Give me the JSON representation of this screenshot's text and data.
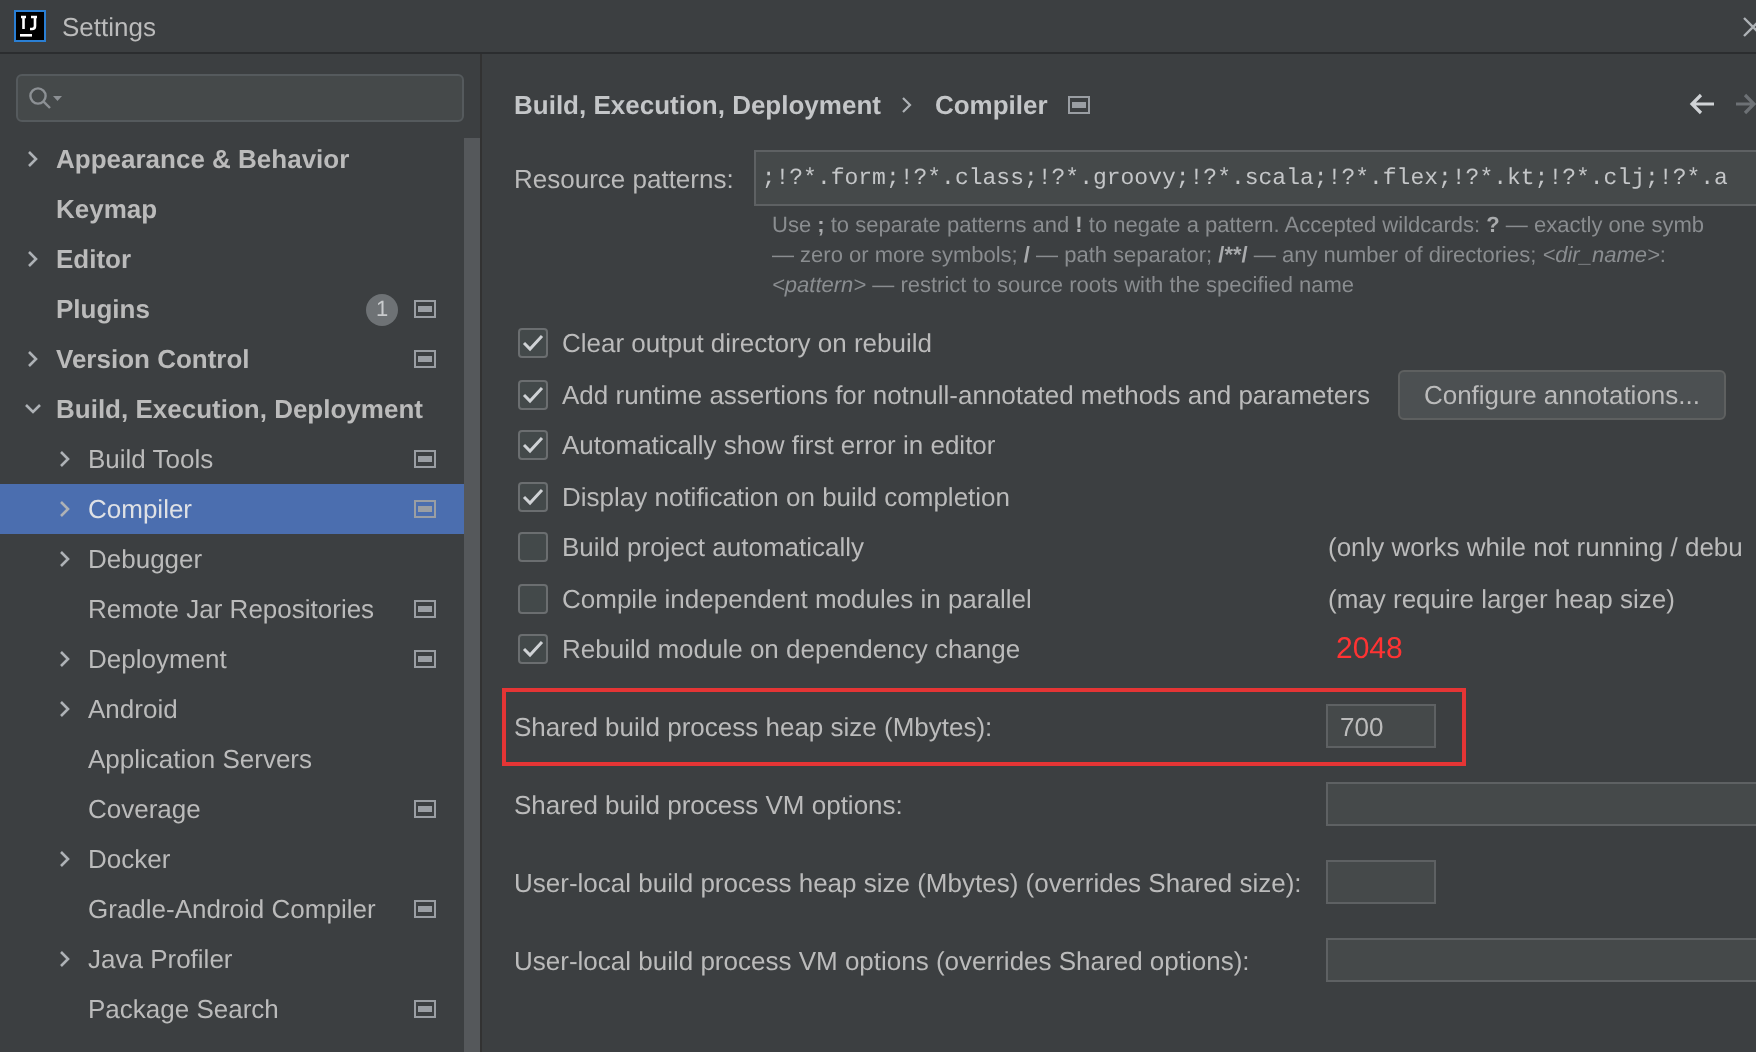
{
  "window": {
    "title": "Settings"
  },
  "sidebar": {
    "items": [
      {
        "label": "Appearance & Behavior",
        "expanded": false,
        "selected": false,
        "scoped": false
      },
      {
        "label": "Keymap",
        "selected": false,
        "scoped": false
      },
      {
        "label": "Editor",
        "expanded": false,
        "selected": false,
        "scoped": false
      },
      {
        "label": "Plugins",
        "selected": false,
        "badge": "1",
        "scoped": true
      },
      {
        "label": "Version Control",
        "expanded": false,
        "selected": false,
        "scoped": true
      },
      {
        "label": "Build, Execution, Deployment",
        "expanded": true,
        "selected": false,
        "scoped": false,
        "children": [
          {
            "label": "Build Tools",
            "expanded": false,
            "selected": false,
            "scoped": true
          },
          {
            "label": "Compiler",
            "expanded": false,
            "selected": true,
            "scoped": true
          },
          {
            "label": "Debugger",
            "expanded": false,
            "selected": false,
            "scoped": false
          },
          {
            "label": "Remote Jar Repositories",
            "selected": false,
            "scoped": true
          },
          {
            "label": "Deployment",
            "expanded": false,
            "selected": false,
            "scoped": true
          },
          {
            "label": "Android",
            "expanded": false,
            "selected": false,
            "scoped": false
          },
          {
            "label": "Application Servers",
            "selected": false,
            "scoped": false
          },
          {
            "label": "Coverage",
            "selected": false,
            "scoped": true
          },
          {
            "label": "Docker",
            "expanded": false,
            "selected": false,
            "scoped": false
          },
          {
            "label": "Gradle-Android Compiler",
            "selected": false,
            "scoped": true
          },
          {
            "label": "Java Profiler",
            "expanded": false,
            "selected": false,
            "scoped": false
          },
          {
            "label": "Package Search",
            "selected": false,
            "scoped": true
          }
        ]
      }
    ]
  },
  "breadcrumb": [
    "Build, Execution, Deployment",
    "Compiler"
  ],
  "resource_patterns": {
    "label": "Resource patterns:",
    "value": ";!?*.form;!?*.class;!?*.groovy;!?*.scala;!?*.flex;!?*.kt;!?*.clj;!?*.a",
    "help_lines": [
      [
        {
          "kind": "plain",
          "text": "Use "
        },
        {
          "kind": "bold",
          "text": ";"
        },
        {
          "kind": "plain",
          "text": " to separate patterns and "
        },
        {
          "kind": "bold",
          "text": "!"
        },
        {
          "kind": "plain",
          "text": " to negate a pattern. Accepted wildcards: "
        },
        {
          "kind": "bold",
          "text": "?"
        },
        {
          "kind": "plain",
          "text": " — exactly one symb"
        }
      ],
      [
        {
          "kind": "plain",
          "text": "— zero or more symbols; "
        },
        {
          "kind": "bold",
          "text": "/"
        },
        {
          "kind": "plain",
          "text": " — path separator; "
        },
        {
          "kind": "bold",
          "text": "/**/"
        },
        {
          "kind": "plain",
          "text": " — any number of directories; "
        },
        {
          "kind": "italic",
          "text": "<dir_name>"
        },
        {
          "kind": "plain",
          "text": ":"
        }
      ],
      [
        {
          "kind": "italic",
          "text": "<pattern>"
        },
        {
          "kind": "plain",
          "text": " — restrict to source roots with the specified name"
        }
      ]
    ]
  },
  "options": [
    {
      "label": "Clear output directory on rebuild",
      "checked": true
    },
    {
      "label": "Add runtime assertions for notnull-annotated methods and parameters",
      "checked": true,
      "button": "Configure annotations..."
    },
    {
      "label": "Automatically show first error in editor",
      "checked": true
    },
    {
      "label": "Display notification on build completion",
      "checked": true
    },
    {
      "label": "Build project automatically",
      "checked": false,
      "note": "(only works while not running / debu"
    },
    {
      "label": "Compile independent modules in parallel",
      "checked": false,
      "note": "(may require larger heap size)"
    },
    {
      "label": "Rebuild module on dependency change",
      "checked": true,
      "annotation": "2048"
    }
  ],
  "fields": [
    {
      "label": "Shared build process heap size (Mbytes):",
      "value": "700",
      "kind": "short",
      "highlighted": true
    },
    {
      "label": "Shared build process VM options:",
      "kind": "wide",
      "highlighted": false
    },
    {
      "label": "User-local build process heap size (Mbytes) (overrides Shared size):",
      "kind": "short",
      "highlighted": false
    },
    {
      "label": "User-local build process VM options (overrides Shared options):",
      "kind": "wide",
      "highlighted": false
    }
  ]
}
